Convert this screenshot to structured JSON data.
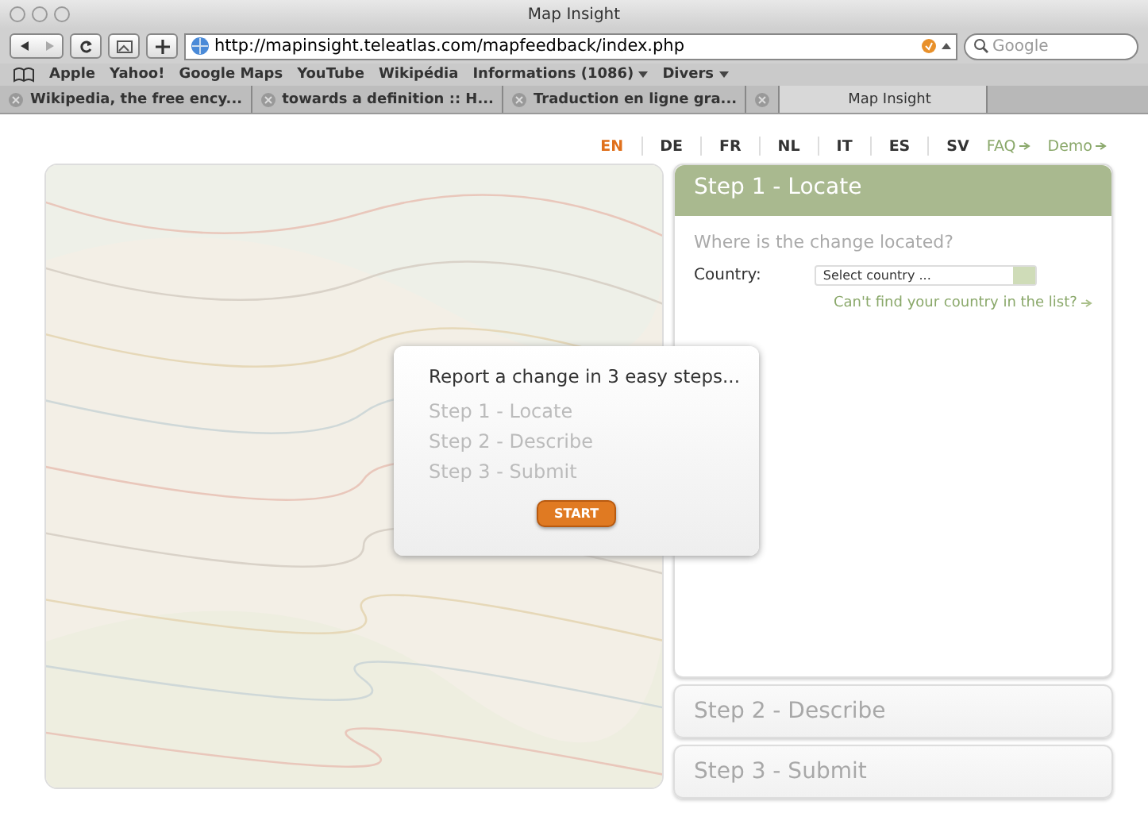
{
  "window": {
    "title": "Map Insight"
  },
  "toolbar": {
    "url": "http://mapinsight.teleatlas.com/mapfeedback/index.php",
    "search_placeholder": "Google"
  },
  "bookmarks": [
    {
      "label": "Apple",
      "menu": false
    },
    {
      "label": "Yahoo!",
      "menu": false
    },
    {
      "label": "Google Maps",
      "menu": false
    },
    {
      "label": "YouTube",
      "menu": false
    },
    {
      "label": "Wikipédia",
      "menu": false
    },
    {
      "label": "Informations (1086)",
      "menu": true
    },
    {
      "label": "Divers",
      "menu": true
    }
  ],
  "tabs": [
    {
      "label": "Wikipedia, the free ency...",
      "selected": false
    },
    {
      "label": "towards a definition :: H...",
      "selected": false
    },
    {
      "label": "Traduction en ligne gra...",
      "selected": false
    },
    {
      "label": "Map Insight",
      "selected": true
    }
  ],
  "languages": [
    {
      "label": "EN",
      "selected": true
    },
    {
      "label": "DE",
      "selected": false
    },
    {
      "label": "FR",
      "selected": false
    },
    {
      "label": "NL",
      "selected": false
    },
    {
      "label": "IT",
      "selected": false
    },
    {
      "label": "ES",
      "selected": false
    },
    {
      "label": "SV",
      "selected": false
    }
  ],
  "links": [
    "FAQ",
    "Demo"
  ],
  "steps": [
    {
      "title": "Step 1 - Locate",
      "expanded": true
    },
    {
      "title": "Step 2 - Describe",
      "expanded": false
    },
    {
      "title": "Step 3 - Submit",
      "expanded": false
    }
  ],
  "locate": {
    "question": "Where is the change located?",
    "country_label": "Country:",
    "country_placeholder": "Select country ...",
    "help_link": "Can't find your country in the list?"
  },
  "popup": {
    "heading": "Report a change in 3 easy steps...",
    "steps": [
      "Step 1 - Locate",
      "Step 2 - Describe",
      "Step 3 - Submit"
    ],
    "button": "START"
  }
}
